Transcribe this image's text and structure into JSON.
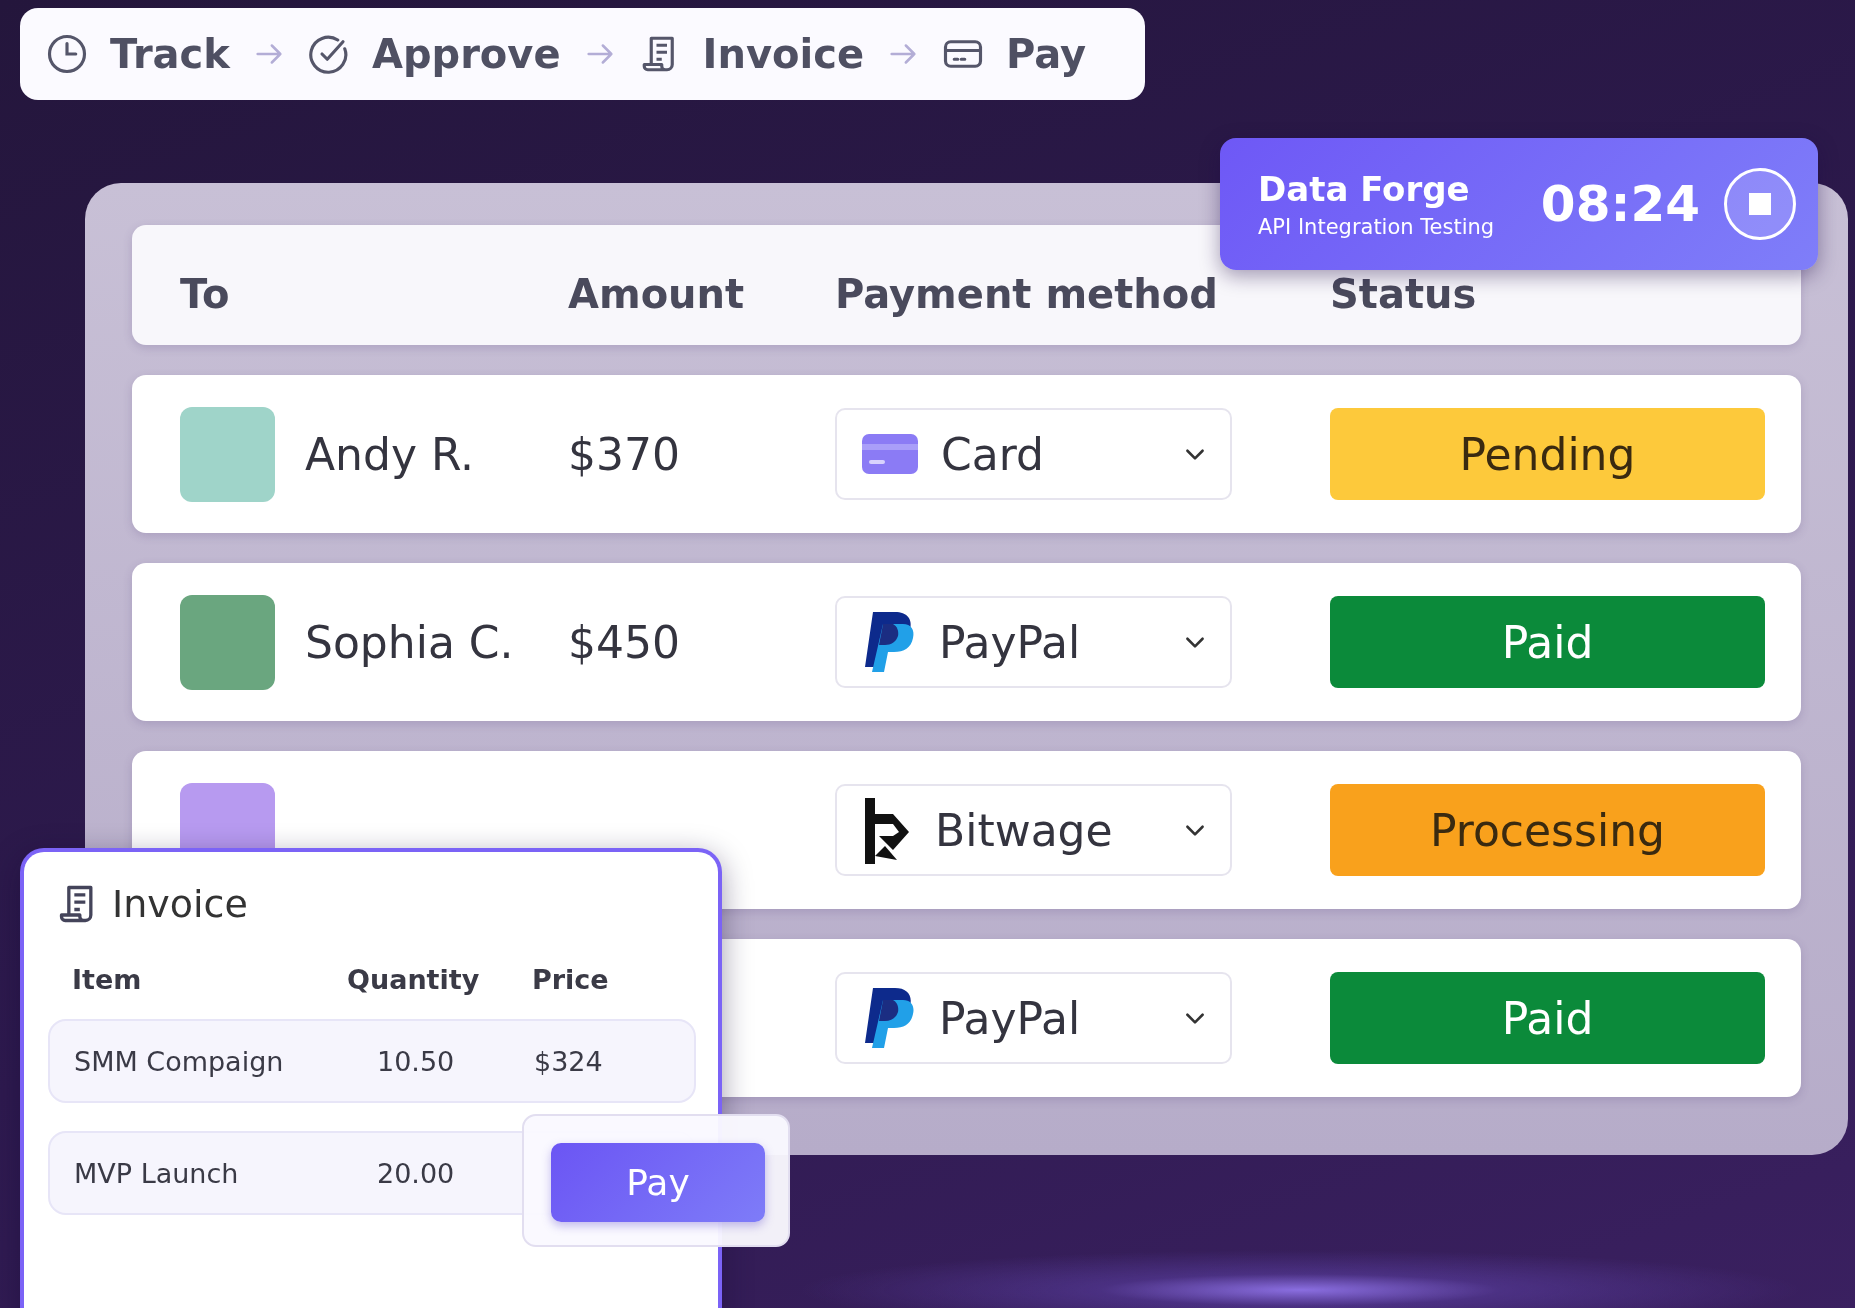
{
  "steps": [
    {
      "kind": "clock",
      "label": "Track"
    },
    {
      "kind": "check",
      "label": "Approve"
    },
    {
      "kind": "receipt",
      "label": "Invoice"
    },
    {
      "kind": "card",
      "label": "Pay"
    }
  ],
  "timer": {
    "project": "Data Forge",
    "task": "API Integration Testing",
    "time": "08:24"
  },
  "table": {
    "columns": [
      "To",
      "Amount",
      "Payment method",
      "Status"
    ],
    "rows": [
      {
        "name": "Andy R.",
        "amount": "$370",
        "kind": "card",
        "method": "Card",
        "status": "Pending",
        "color": "#fdc93b"
      },
      {
        "name": "Sophia C.",
        "amount": "$450",
        "kind": "paypal",
        "method": "PayPal",
        "status": "Paid",
        "color": "#0b8a3a"
      },
      {
        "kind": "bitwage",
        "method": "Bitwage",
        "status": "Processing",
        "color": "#f9a11c"
      },
      {
        "kind": "paypal",
        "method": "PayPal",
        "status": "Paid",
        "color": "#0b8a3a"
      }
    ]
  },
  "invoice": {
    "title": "Invoice",
    "columns": [
      "Item",
      "Quantity",
      "Price"
    ],
    "rows": [
      {
        "item": "SMM Compaign",
        "quantity": "10.50",
        "price": "$324"
      },
      {
        "item": "MVP Launch",
        "quantity": "20.00"
      }
    ],
    "pay_button": "Pay"
  }
}
